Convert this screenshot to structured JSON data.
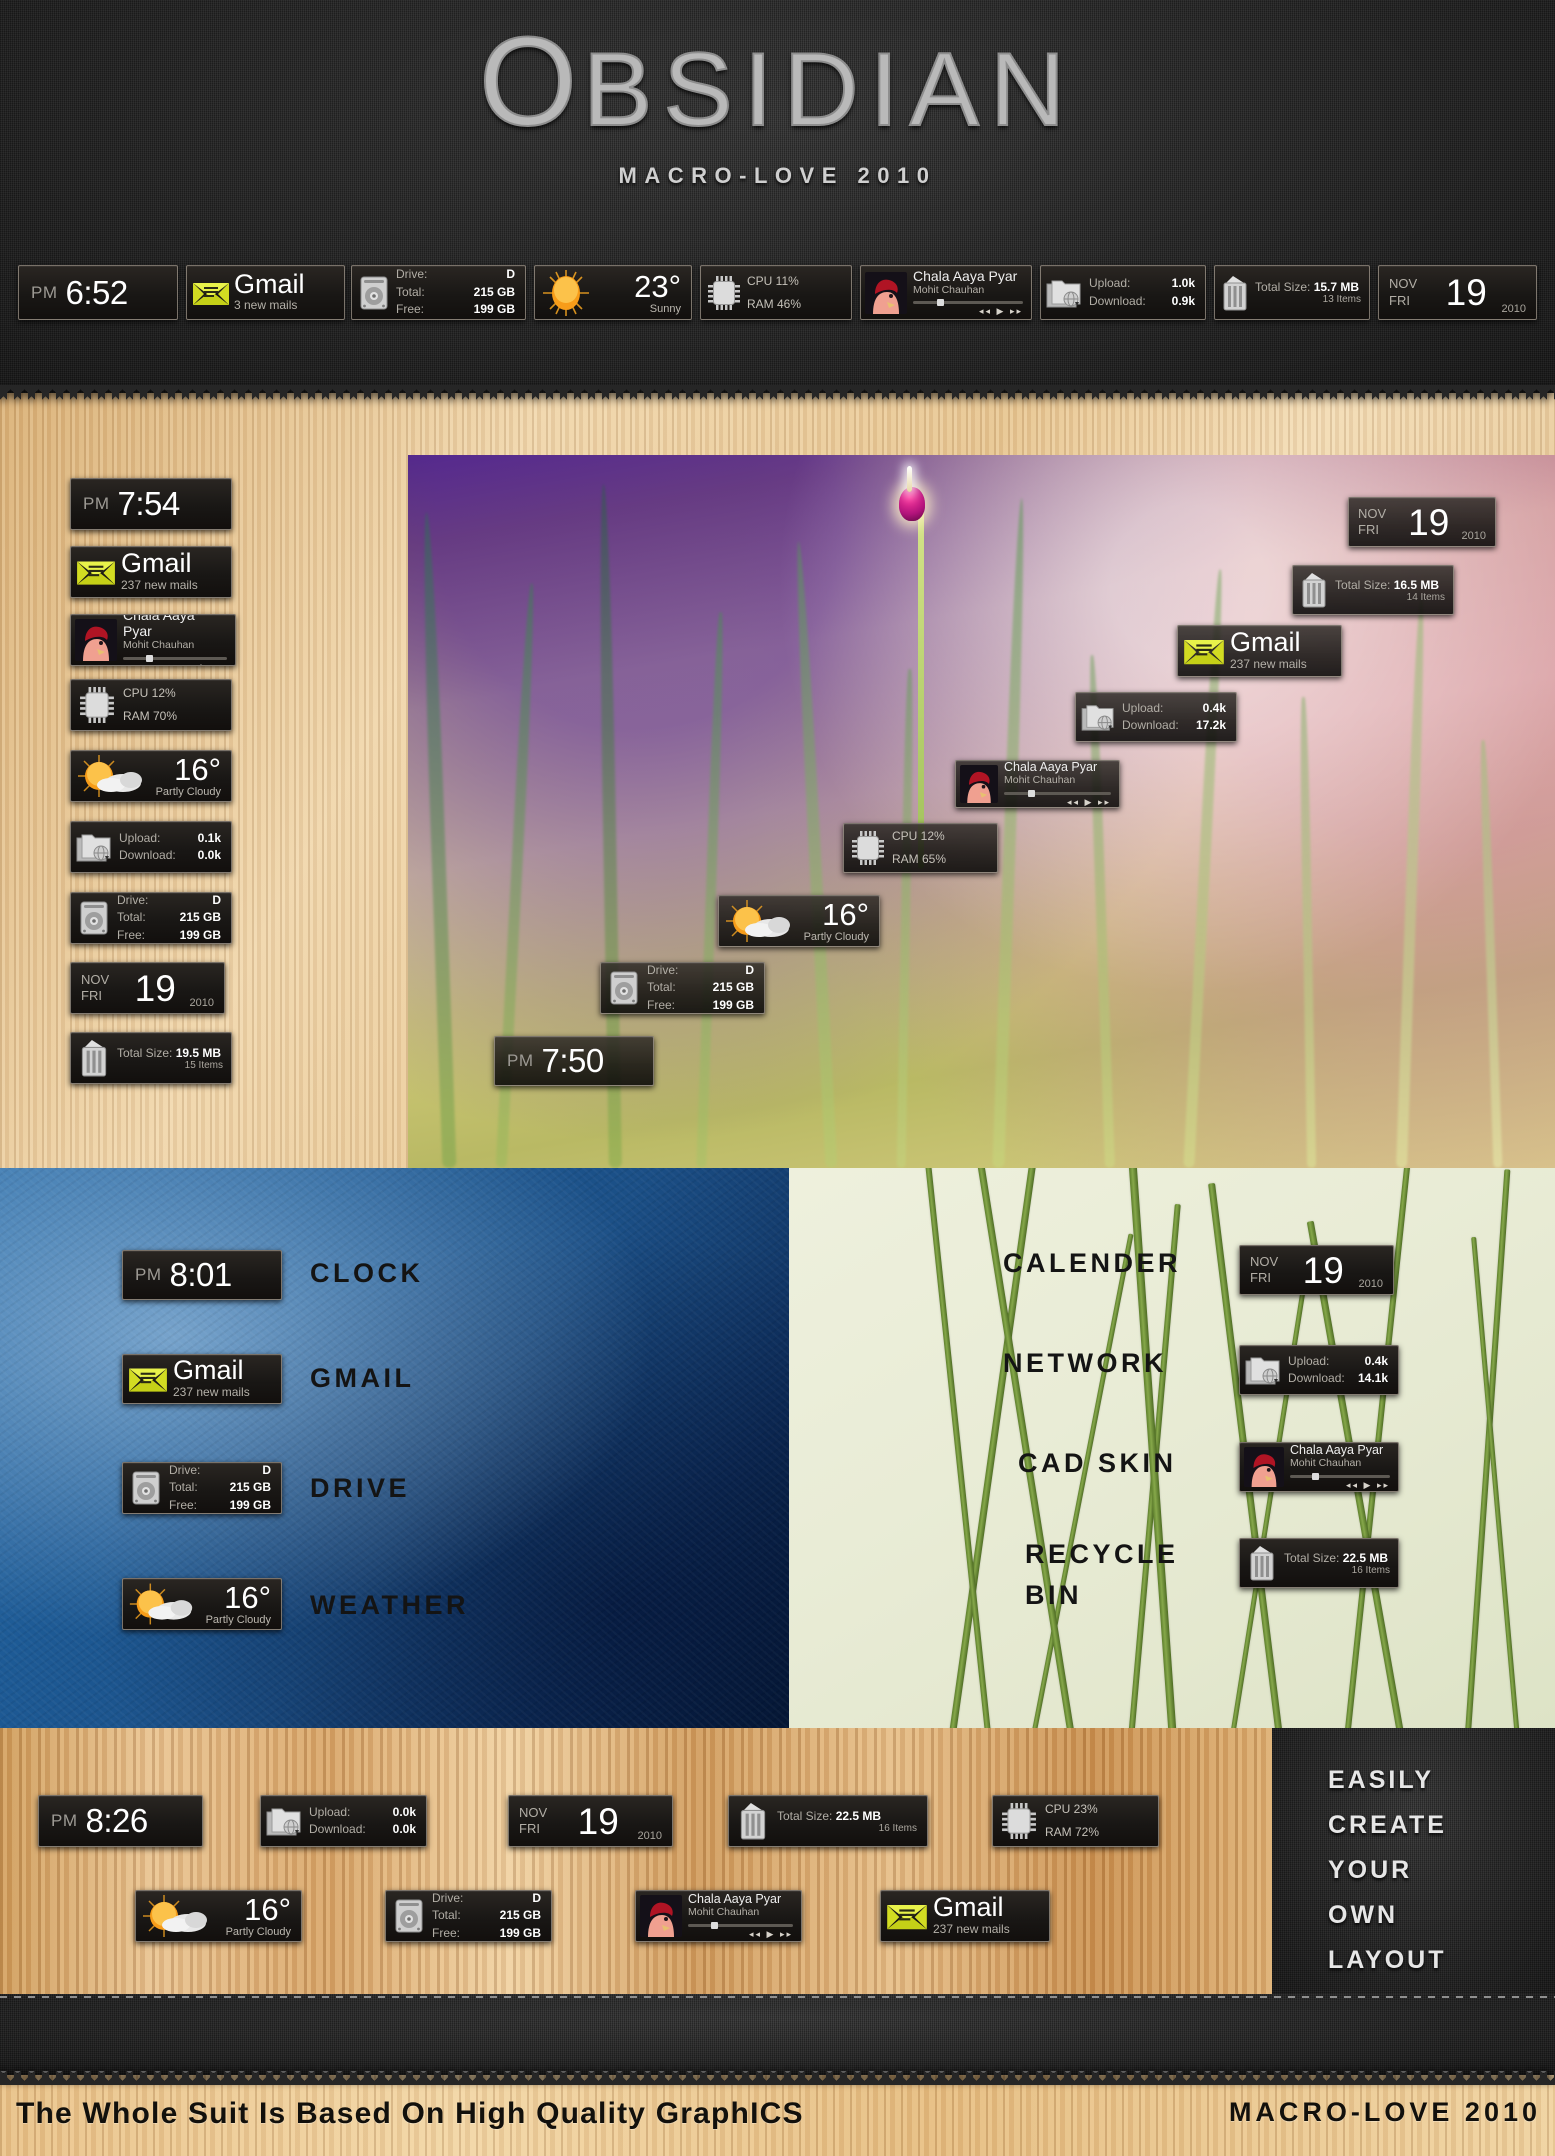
{
  "header": {
    "logo_first": "O",
    "logo_rest": "BSIDIAN",
    "subtitle": "MACRO-LOVE 2010"
  },
  "labels": {
    "drive": "Drive:",
    "total": "Total:",
    "free": "Free:",
    "upload": "Upload:",
    "download": "Download:",
    "total_size": "Total Size:"
  },
  "topbar": {
    "clock": {
      "ampm": "PM",
      "time": "6:52"
    },
    "gmail": {
      "name": "Gmail",
      "sub": "3 new mails"
    },
    "drive": {
      "drive": "D",
      "total": "215 GB",
      "free": "199 GB"
    },
    "weather": {
      "temp": "23°",
      "cond": "Sunny"
    },
    "cpu": {
      "cpu": "CPU 11%",
      "ram": "RAM 46%"
    },
    "media": {
      "title": "Chala Aaya Pyar",
      "artist": "Mohit Chauhan"
    },
    "network": {
      "upload": "1.0k",
      "download": "0.9k"
    },
    "bin": {
      "size": "15.7 MB",
      "items": "13 Items"
    },
    "date": {
      "month": "NOV",
      "day": "FRI",
      "num": "19",
      "year": "2010"
    }
  },
  "sidebar": {
    "clock": {
      "ampm": "PM",
      "time": "7:54"
    },
    "gmail": {
      "name": "Gmail",
      "sub": "237 new mails"
    },
    "media": {
      "title": "Chala Aaya Pyar",
      "artist": "Mohit Chauhan"
    },
    "cpu": {
      "cpu": "CPU 12%",
      "ram": "RAM 70%"
    },
    "weather": {
      "temp": "16°",
      "cond": "Partly Cloudy"
    },
    "network": {
      "upload": "0.1k",
      "download": "0.0k"
    },
    "drive": {
      "drive": "D",
      "total": "215 GB",
      "free": "199 GB"
    },
    "date": {
      "month": "NOV",
      "day": "FRI",
      "num": "19",
      "year": "2010"
    },
    "bin": {
      "size": "19.5 MB",
      "items": "15 Items"
    }
  },
  "desktop": {
    "date": {
      "month": "NOV",
      "day": "FRI",
      "num": "19",
      "year": "2010"
    },
    "bin": {
      "size": "16.5 MB",
      "items": "14 Items"
    },
    "gmail": {
      "name": "Gmail",
      "sub": "237 new mails"
    },
    "network": {
      "upload": "0.4k",
      "download": "17.2k"
    },
    "media": {
      "title": "Chala Aaya Pyar",
      "artist": "Mohit Chauhan"
    },
    "cpu": {
      "cpu": "CPU 12%",
      "ram": "RAM 65%"
    },
    "weather": {
      "temp": "16°",
      "cond": "Partly Cloudy"
    },
    "drive": {
      "drive": "D",
      "total": "215 GB",
      "free": "199 GB"
    },
    "clock": {
      "ampm": "PM",
      "time": "7:50"
    }
  },
  "blue_section": {
    "labels": [
      "CLOCK",
      "GMAIL",
      "DRIVE",
      "WEATHER"
    ],
    "clock": {
      "ampm": "PM",
      "time": "8:01"
    },
    "gmail": {
      "name": "Gmail",
      "sub": "237 new mails"
    },
    "drive": {
      "drive": "D",
      "total": "215 GB",
      "free": "199 GB"
    },
    "weather": {
      "temp": "16°",
      "cond": "Partly Cloudy"
    }
  },
  "green_section": {
    "labels": [
      "CALENDER",
      "NETWORK",
      "CAD SKIN",
      "RECYCLE",
      "BIN"
    ],
    "date": {
      "month": "NOV",
      "day": "FRI",
      "num": "19",
      "year": "2010"
    },
    "network": {
      "upload": "0.4k",
      "download": "14.1k"
    },
    "media": {
      "title": "Chala Aaya Pyar",
      "artist": "Mohit Chauhan"
    },
    "bin": {
      "size": "22.5 MB",
      "items": "16 Items"
    }
  },
  "strip": {
    "clock": {
      "ampm": "PM",
      "time": "8:26"
    },
    "network": {
      "upload": "0.0k",
      "download": "0.0k"
    },
    "date": {
      "month": "NOV",
      "day": "FRI",
      "num": "19",
      "year": "2010"
    },
    "bin": {
      "size": "22.5 MB",
      "items": "16 Items"
    },
    "cpu": {
      "cpu": "CPU 23%",
      "ram": "RAM 72%"
    },
    "weather": {
      "temp": "16°",
      "cond": "Partly Cloudy"
    },
    "drive": {
      "drive": "D",
      "total": "215 GB",
      "free": "199 GB"
    },
    "media": {
      "title": "Chala Aaya Pyar",
      "artist": "Mohit Chauhan"
    },
    "gmail": {
      "name": "Gmail",
      "sub": "237 new mails"
    }
  },
  "promo_panel": {
    "lines": [
      "EASILY",
      "CREATE",
      "YOUR",
      "OWN",
      "LAYOUT"
    ]
  },
  "footer": {
    "tagline": "The Whole Suit Is Based On High Quality GraphICS",
    "credit": "MACRO-LOVE 2010"
  },
  "colors": {
    "gmail_yellow": "#d6e02a",
    "weather_orange": "#f79c19",
    "accent_wood": "#d9a763"
  }
}
